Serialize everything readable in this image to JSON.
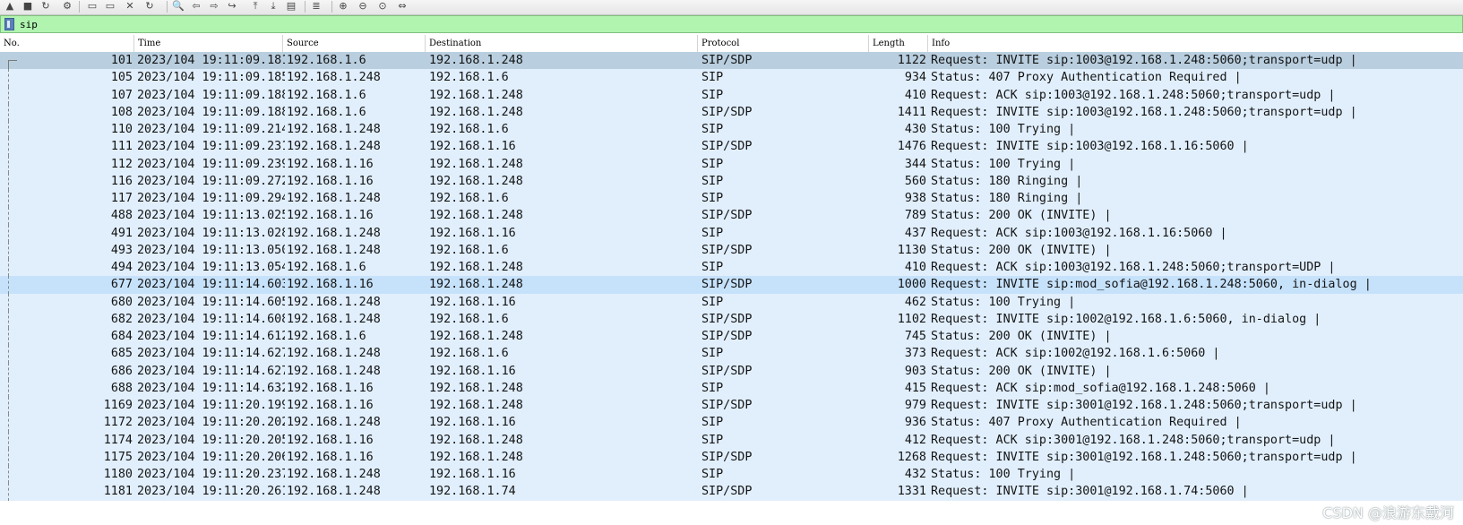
{
  "toolbar": {
    "icons": [
      "shark-fin-icon",
      "stop-icon",
      "restart-icon",
      "options-icon",
      "open-folder-icon",
      "save-binary-icon",
      "close-file-icon",
      "reload-icon",
      "find-icon",
      "back-icon",
      "forward-icon",
      "goto-icon",
      "first-icon",
      "last-icon",
      "autoscroll-icon",
      "colorize-icon",
      "zoom-in-icon",
      "zoom-out-icon",
      "zoom-normal-icon",
      "resize-columns-icon"
    ],
    "glyphs": [
      "▲",
      "■",
      "↻",
      "⚙",
      "▭",
      "▭",
      "✕",
      "↻",
      "🔍",
      "⇦",
      "⇨",
      "↪",
      "⤒",
      "⤓",
      "▤",
      "≣",
      "⊕",
      "⊖",
      "⊙",
      "⇔"
    ]
  },
  "filter": {
    "value": "sip"
  },
  "columns": {
    "no": "No.",
    "time": "Time",
    "source": "Source",
    "destination": "Destination",
    "protocol": "Protocol",
    "length": "Length",
    "info": "Info"
  },
  "packets": [
    {
      "no": "101",
      "time": "2023/104 19:11:09.181",
      "src": "192.168.1.6",
      "dst": "192.168.1.248",
      "proto": "SIP/SDP",
      "len": "1122",
      "info": "Request: INVITE sip:1003@192.168.1.248:5060;transport=udp |"
    },
    {
      "no": "105",
      "time": "2023/104 19:11:09.185",
      "src": "192.168.1.248",
      "dst": "192.168.1.6",
      "proto": "SIP",
      "len": "934",
      "info": "Status: 407 Proxy Authentication Required |"
    },
    {
      "no": "107",
      "time": "2023/104 19:11:09.188",
      "src": "192.168.1.6",
      "dst": "192.168.1.248",
      "proto": "SIP",
      "len": "410",
      "info": "Request: ACK sip:1003@192.168.1.248:5060;transport=udp |"
    },
    {
      "no": "108",
      "time": "2023/104 19:11:09.188",
      "src": "192.168.1.6",
      "dst": "192.168.1.248",
      "proto": "SIP/SDP",
      "len": "1411",
      "info": "Request: INVITE sip:1003@192.168.1.248:5060;transport=udp |"
    },
    {
      "no": "110",
      "time": "2023/104 19:11:09.214",
      "src": "192.168.1.248",
      "dst": "192.168.1.6",
      "proto": "SIP",
      "len": "430",
      "info": "Status: 100 Trying |"
    },
    {
      "no": "111",
      "time": "2023/104 19:11:09.231",
      "src": "192.168.1.248",
      "dst": "192.168.1.16",
      "proto": "SIP/SDP",
      "len": "1476",
      "info": "Request: INVITE sip:1003@192.168.1.16:5060 |"
    },
    {
      "no": "112",
      "time": "2023/104 19:11:09.239",
      "src": "192.168.1.16",
      "dst": "192.168.1.248",
      "proto": "SIP",
      "len": "344",
      "info": "Status: 100 Trying |"
    },
    {
      "no": "116",
      "time": "2023/104 19:11:09.272",
      "src": "192.168.1.16",
      "dst": "192.168.1.248",
      "proto": "SIP",
      "len": "560",
      "info": "Status: 180 Ringing |"
    },
    {
      "no": "117",
      "time": "2023/104 19:11:09.294",
      "src": "192.168.1.248",
      "dst": "192.168.1.6",
      "proto": "SIP",
      "len": "938",
      "info": "Status: 180 Ringing |"
    },
    {
      "no": "488",
      "time": "2023/104 19:11:13.025",
      "src": "192.168.1.16",
      "dst": "192.168.1.248",
      "proto": "SIP/SDP",
      "len": "789",
      "info": "Status: 200 OK (INVITE) |"
    },
    {
      "no": "491",
      "time": "2023/104 19:11:13.028",
      "src": "192.168.1.248",
      "dst": "192.168.1.16",
      "proto": "SIP",
      "len": "437",
      "info": "Request: ACK sip:1003@192.168.1.16:5060 |"
    },
    {
      "no": "493",
      "time": "2023/104 19:11:13.050",
      "src": "192.168.1.248",
      "dst": "192.168.1.6",
      "proto": "SIP/SDP",
      "len": "1130",
      "info": "Status: 200 OK (INVITE) |"
    },
    {
      "no": "494",
      "time": "2023/104 19:11:13.054",
      "src": "192.168.1.6",
      "dst": "192.168.1.248",
      "proto": "SIP",
      "len": "410",
      "info": "Request: ACK sip:1003@192.168.1.248:5060;transport=UDP |"
    },
    {
      "no": "677",
      "time": "2023/104 19:11:14.603",
      "src": "192.168.1.16",
      "dst": "192.168.1.248",
      "proto": "SIP/SDP",
      "len": "1000",
      "info": "Request: INVITE sip:mod_sofia@192.168.1.248:5060, in-dialog |"
    },
    {
      "no": "680",
      "time": "2023/104 19:11:14.605",
      "src": "192.168.1.248",
      "dst": "192.168.1.16",
      "proto": "SIP",
      "len": "462",
      "info": "Status: 100 Trying |"
    },
    {
      "no": "682",
      "time": "2023/104 19:11:14.608",
      "src": "192.168.1.248",
      "dst": "192.168.1.6",
      "proto": "SIP/SDP",
      "len": "1102",
      "info": "Request: INVITE sip:1002@192.168.1.6:5060, in-dialog |"
    },
    {
      "no": "684",
      "time": "2023/104 19:11:14.612",
      "src": "192.168.1.6",
      "dst": "192.168.1.248",
      "proto": "SIP/SDP",
      "len": "745",
      "info": "Status: 200 OK (INVITE) |"
    },
    {
      "no": "685",
      "time": "2023/104 19:11:14.627",
      "src": "192.168.1.248",
      "dst": "192.168.1.6",
      "proto": "SIP",
      "len": "373",
      "info": "Request: ACK sip:1002@192.168.1.6:5060 |"
    },
    {
      "no": "686",
      "time": "2023/104 19:11:14.627",
      "src": "192.168.1.248",
      "dst": "192.168.1.16",
      "proto": "SIP/SDP",
      "len": "903",
      "info": "Status: 200 OK (INVITE) |"
    },
    {
      "no": "688",
      "time": "2023/104 19:11:14.632",
      "src": "192.168.1.16",
      "dst": "192.168.1.248",
      "proto": "SIP",
      "len": "415",
      "info": "Request: ACK sip:mod_sofia@192.168.1.248:5060 |"
    },
    {
      "no": "1169",
      "time": "2023/104 19:11:20.199",
      "src": "192.168.1.16",
      "dst": "192.168.1.248",
      "proto": "SIP/SDP",
      "len": "979",
      "info": "Request: INVITE sip:3001@192.168.1.248:5060;transport=udp |"
    },
    {
      "no": "1172",
      "time": "2023/104 19:11:20.202",
      "src": "192.168.1.248",
      "dst": "192.168.1.16",
      "proto": "SIP",
      "len": "936",
      "info": "Status: 407 Proxy Authentication Required |"
    },
    {
      "no": "1174",
      "time": "2023/104 19:11:20.205",
      "src": "192.168.1.16",
      "dst": "192.168.1.248",
      "proto": "SIP",
      "len": "412",
      "info": "Request: ACK sip:3001@192.168.1.248:5060;transport=udp |"
    },
    {
      "no": "1175",
      "time": "2023/104 19:11:20.206",
      "src": "192.168.1.16",
      "dst": "192.168.1.248",
      "proto": "SIP/SDP",
      "len": "1268",
      "info": "Request: INVITE sip:3001@192.168.1.248:5060;transport=udp |"
    },
    {
      "no": "1180",
      "time": "2023/104 19:11:20.237",
      "src": "192.168.1.248",
      "dst": "192.168.1.16",
      "proto": "SIP",
      "len": "432",
      "info": "Status: 100 Trying |"
    },
    {
      "no": "1181",
      "time": "2023/104 19:11:20.261",
      "src": "192.168.1.248",
      "dst": "192.168.1.74",
      "proto": "SIP/SDP",
      "len": "1331",
      "info": "Request: INVITE sip:3001@192.168.1.74:5060 |"
    }
  ],
  "watermark": "CSDN @浪游东戴河"
}
